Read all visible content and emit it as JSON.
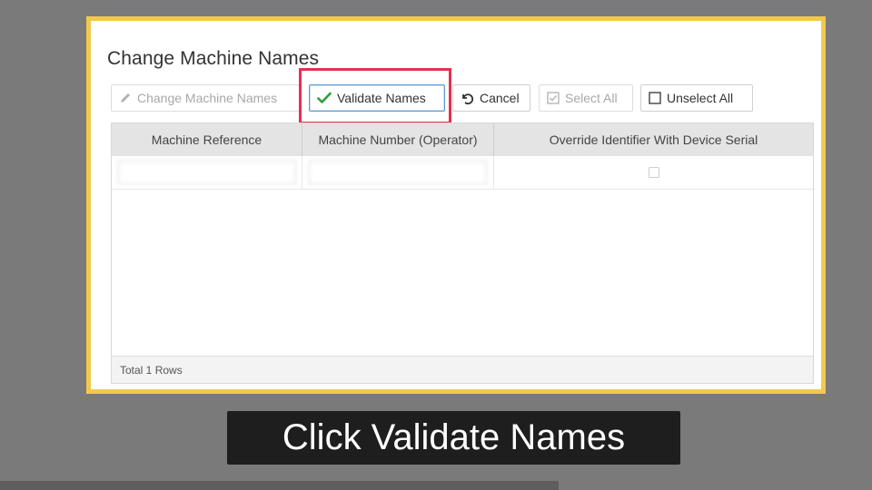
{
  "dialog": {
    "title": "Change Machine Names"
  },
  "toolbar": {
    "change_names_label": "Change Machine Names",
    "validate_label": "Validate Names",
    "cancel_label": "Cancel",
    "select_all_label": "Select All",
    "unselect_all_label": "Unselect All"
  },
  "grid": {
    "columns": [
      "Machine Reference",
      "Machine Number (Operator)",
      "Override Identifier With Device Serial"
    ],
    "rows": [
      {
        "machine_reference": "",
        "machine_number": "",
        "override_checked": false
      }
    ],
    "footer": "Total 1 Rows"
  },
  "caption": {
    "text": "Click Validate Names"
  },
  "colors": {
    "highlight_frame": "#f2c94c",
    "callout_box": "#e5304f",
    "check_green": "#2e9e3e",
    "caption_bg": "#1e1e1e"
  },
  "icons": {
    "change_names": "pencil-icon",
    "validate": "check-icon",
    "cancel": "undo-icon",
    "select_all": "checked-box-icon",
    "unselect_all": "empty-box-icon"
  }
}
